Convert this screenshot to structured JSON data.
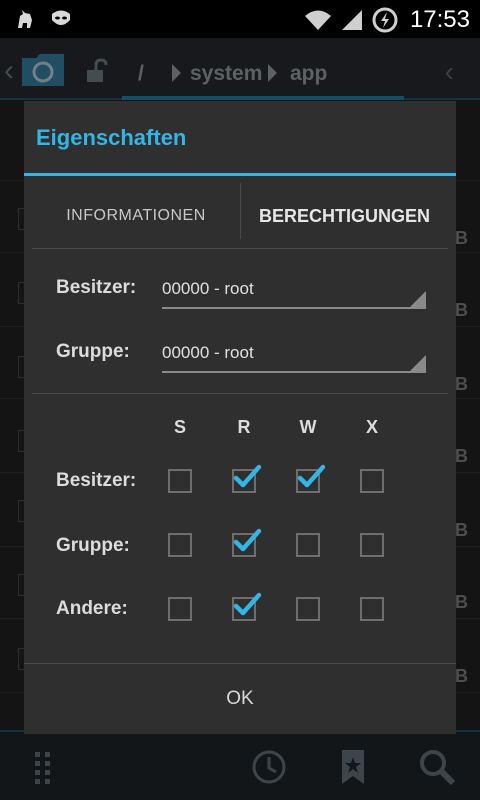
{
  "status_bar": {
    "time": "17:53"
  },
  "breadcrumb": {
    "root": "/",
    "items": [
      "system",
      "app"
    ]
  },
  "dialog": {
    "title": "Eigenschaften",
    "tabs": [
      "INFORMATIONEN",
      "BERECHTIGUNGEN"
    ],
    "active_tab": "BERECHTIGUNGEN",
    "owner": {
      "label": "Besitzer:",
      "value": "00000 - root"
    },
    "group": {
      "label": "Gruppe:",
      "value": "00000 - root"
    },
    "columns": [
      "S",
      "R",
      "W",
      "X"
    ],
    "rows": [
      {
        "label": "Besitzer:",
        "S": false,
        "R": true,
        "W": true,
        "X": false
      },
      {
        "label": "Gruppe:",
        "S": false,
        "R": true,
        "W": false,
        "X": false
      },
      {
        "label": "Andere:",
        "S": false,
        "R": true,
        "W": false,
        "X": false
      }
    ],
    "ok_label": "OK"
  },
  "background_list": {
    "size_suffix": "B"
  },
  "colors": {
    "accent": "#33b5e5",
    "dialog_bg": "#2f2f2f"
  }
}
